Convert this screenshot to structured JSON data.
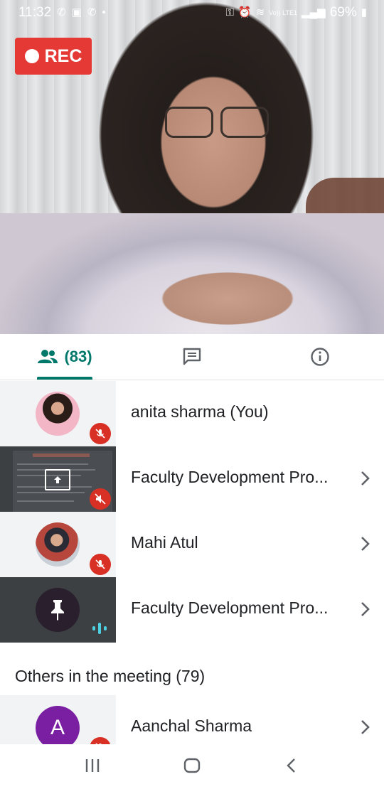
{
  "status_bar": {
    "time": "11:32",
    "network": "Vo)) LTE1",
    "battery": "69%"
  },
  "recording": {
    "label": "REC"
  },
  "tabs": {
    "people_count": "(83)",
    "people_icon": "people-icon",
    "chat_icon": "chat-icon",
    "info_icon": "info-icon"
  },
  "participants": [
    {
      "name": "anita sharma (You)",
      "muted": true
    },
    {
      "name": "Faculty Development Pro...",
      "presenting": true,
      "muted": true
    },
    {
      "name": "Mahi Atul",
      "muted": true
    },
    {
      "name": "Faculty Development Pro...",
      "pinned": true,
      "speaking": true
    }
  ],
  "others": {
    "title": "Others in the meeting (79)",
    "items": [
      {
        "name": "Aanchal Sharma",
        "initial": "A",
        "avatar_color": "#7b1fa2"
      }
    ]
  },
  "colors": {
    "accent": "#00796b",
    "rec": "#e53935",
    "mute": "#d93025"
  }
}
